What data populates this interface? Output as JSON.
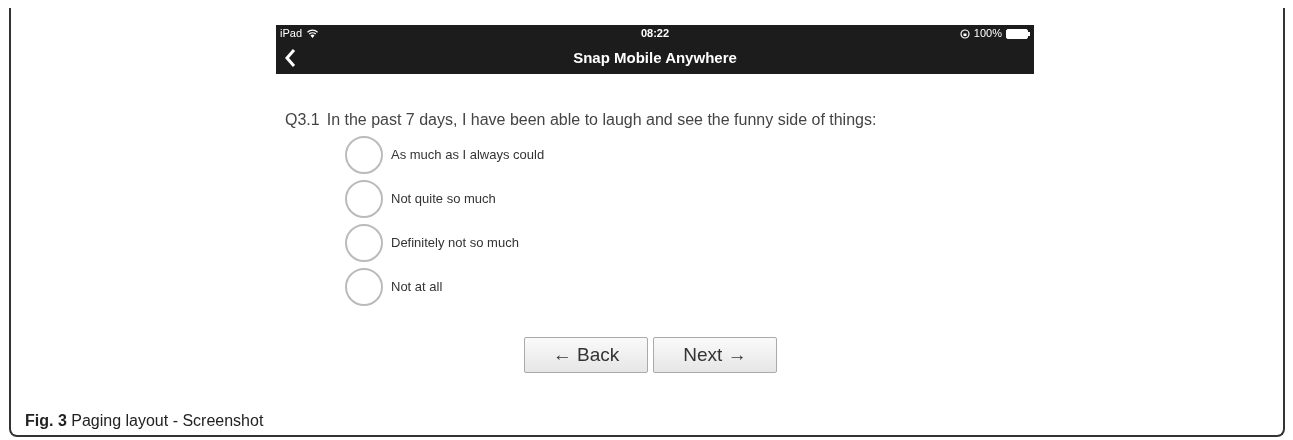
{
  "status_bar": {
    "device": "iPad",
    "time": "08:22",
    "battery": "100%"
  },
  "nav_bar": {
    "title": "Snap Mobile Anywhere"
  },
  "question": {
    "number": "Q3.1",
    "text": "In the past 7 days, I have been able to laugh and see the funny side of things:"
  },
  "options": [
    {
      "label": "As much as I always could",
      "selected": false
    },
    {
      "label": "Not quite so much",
      "selected": false
    },
    {
      "label": "Definitely not so much",
      "selected": false
    },
    {
      "label": "Not at all",
      "selected": false
    }
  ],
  "buttons": [
    "← Back",
    "Next →"
  ],
  "caption": "**Fig. 3** Paging layout - Screenshot"
}
